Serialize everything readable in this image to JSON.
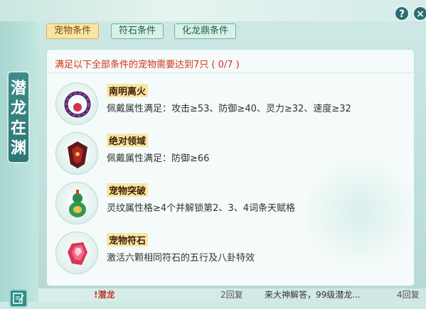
{
  "side": {
    "title": "潜龙在渊"
  },
  "buttons": {
    "help": "?",
    "close": "×"
  },
  "tabs": [
    {
      "label": "宠物条件"
    },
    {
      "label": "符石条件"
    },
    {
      "label": "化龙鼎条件"
    }
  ],
  "header": "满足以下全部条件的宠物需要达到7只 ( 0/7 )",
  "items": [
    {
      "title": "南明离火",
      "desc": "佩戴属性满足：攻击≥53、防御≥40、灵力≥32、速度≥32",
      "icon": "fire-ring-icon"
    },
    {
      "title": "绝对领域",
      "desc": "佩戴属性满足：防御≥66",
      "icon": "armor-icon"
    },
    {
      "title": "宠物突破",
      "desc": "灵纹属性格≥4个并解锁第2、3、4词条天赋格",
      "icon": "gourd-icon"
    },
    {
      "title": "宠物符石",
      "desc": "激活六颗相同符石的五行及八卦特效",
      "icon": "crystal-icon"
    }
  ],
  "footer": {
    "left": "!潜龙",
    "reply": "2回复",
    "text": "来大神解答，99级潜龙...",
    "reply2": "4回复"
  }
}
